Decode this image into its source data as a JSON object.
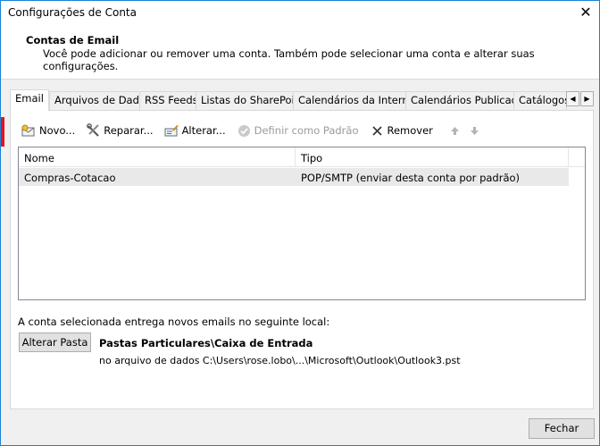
{
  "window": {
    "title": "Configurações de Conta",
    "close_glyph": "✕"
  },
  "header": {
    "title": "Contas de Email",
    "description": "Você pode adicionar ou remover uma conta. Também pode selecionar uma conta e alterar suas configurações."
  },
  "tabs": [
    {
      "label": "Email",
      "active": true
    },
    {
      "label": "Arquivos de Dados"
    },
    {
      "label": "RSS Feeds"
    },
    {
      "label": "Listas do SharePoint"
    },
    {
      "label": "Calendários da Internet"
    },
    {
      "label": "Calendários Publicados"
    },
    {
      "label": "Catálogos"
    }
  ],
  "tab_scroll": {
    "left": "◀",
    "right": "▶"
  },
  "toolbar": {
    "new_label": "Novo...",
    "repair_label": "Reparar...",
    "change_label": "Alterar...",
    "default_label": "Definir como Padrão",
    "remove_label": "Remover"
  },
  "table": {
    "columns": [
      "Nome",
      "Tipo"
    ],
    "rows": [
      {
        "name": "Compras-Cotacao",
        "type": "POP/SMTP (enviar desta conta por padrão)"
      }
    ]
  },
  "delivery": {
    "label": "A conta selecionada entrega novos emails no seguinte local:",
    "change_folder_label": "Alterar Pasta",
    "folder": "Pastas Particulares\\Caixa de Entrada",
    "file": "no arquivo de dados C:\\Users\\rose.lobo\\...\\Microsoft\\Outlook\\Outlook3.pst"
  },
  "footer": {
    "close_label": "Fechar"
  },
  "colors": {
    "accent_border": "#1883d7",
    "selection_row": "#e9e9e9",
    "edge_marker": "#e81123"
  }
}
